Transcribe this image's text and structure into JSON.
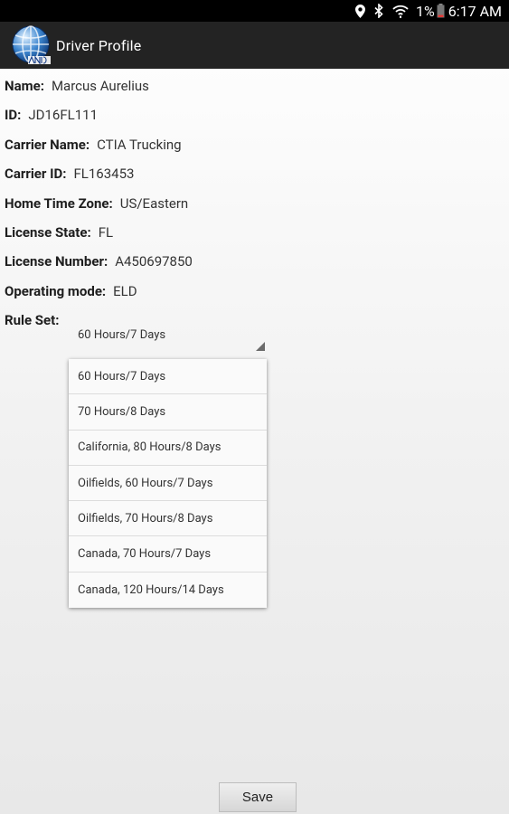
{
  "status_bar": {
    "icons": [
      "location-icon",
      "bluetooth-icon",
      "wifi-icon",
      "battery-icon"
    ],
    "battery": "1%",
    "time": "6:17 AM"
  },
  "action_bar": {
    "logo": "globe-logo",
    "title": "Driver Profile"
  },
  "profile": {
    "fields": [
      {
        "label": "Name:",
        "value": "Marcus Aurelius"
      },
      {
        "label": "ID:",
        "value": "JD16FL111"
      },
      {
        "label": "Carrier Name:",
        "value": "CTIA Trucking"
      },
      {
        "label": "Carrier ID:",
        "value": "FL163453"
      },
      {
        "label": "Home Time Zone:",
        "value": "US/Eastern"
      },
      {
        "label": "License State:",
        "value": "FL"
      },
      {
        "label": "License Number:",
        "value": "A450697850"
      },
      {
        "label": "Operating mode:",
        "value": "ELD"
      }
    ],
    "rule_set_label": "Rule Set:",
    "rule_set_selected": "60 Hours/7 Days"
  },
  "rule_set_options": [
    "60 Hours/7 Days",
    "70 Hours/8 Days",
    "California, 80 Hours/8 Days",
    "Oilfields, 60 Hours/7 Days",
    "Oilfields, 70 Hours/8 Days",
    "Canada, 70 Hours/7 Days",
    "Canada, 120 Hours/14 Days"
  ],
  "save_label": "Save",
  "colors": {
    "status_bar": "#000000",
    "action_bar": "#232323",
    "background": "#f4f4f4"
  }
}
